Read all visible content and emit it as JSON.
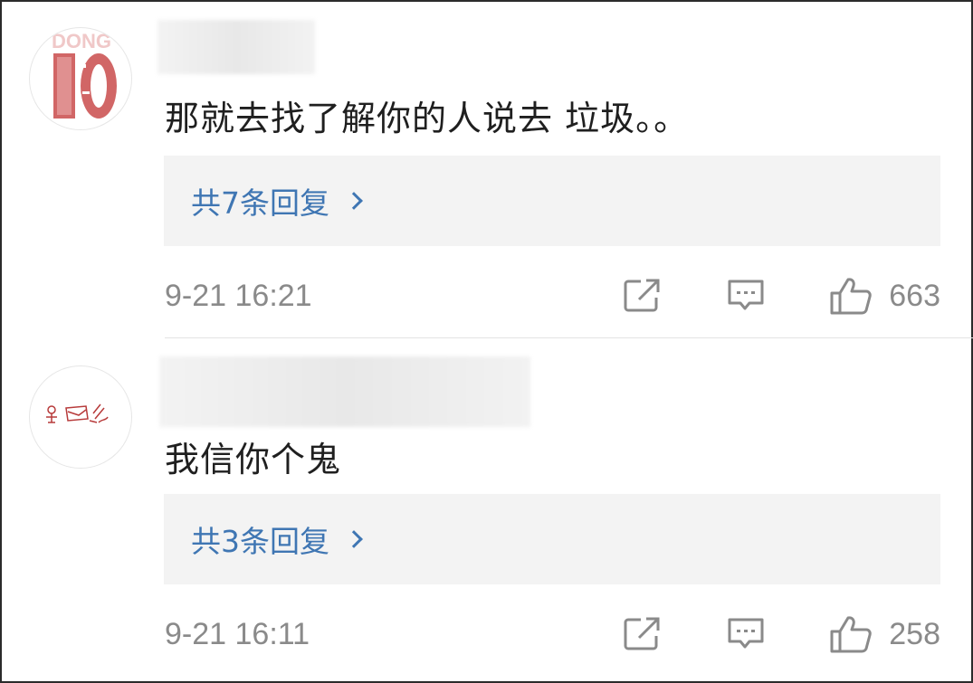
{
  "comments": [
    {
      "text": "那就去找了解你的人说去 垃圾。。",
      "replies_label": "共7条回复",
      "time": "9-21 16:21",
      "likes": "663",
      "avatar_icon": "number-10-collage-avatar"
    },
    {
      "text": "我信你个鬼",
      "replies_label": "共3条回复",
      "time": "9-21 16:11",
      "likes": "258",
      "avatar_icon": "doodle-avatar"
    }
  ],
  "colors": {
    "link": "#3f76b3",
    "meta": "#8a8a8a",
    "reply_bg": "#f3f3f3"
  }
}
